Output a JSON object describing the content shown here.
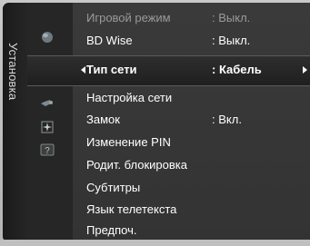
{
  "sidebar": {
    "title": "Установка"
  },
  "icons": [
    "picture-icon",
    "setup-icon",
    "sound-icon",
    "channel-icon",
    "support-icon"
  ],
  "menu": {
    "items": [
      {
        "label": "Игровой режим",
        "value": ": Выкл.",
        "state": "dim"
      },
      {
        "label": "BD Wise",
        "value": ": Выкл.",
        "state": "normal"
      },
      {
        "label": "Тип сети",
        "value": ": Кабель",
        "state": "selected"
      },
      {
        "label": "Настройка сети",
        "value": "",
        "state": "normal"
      },
      {
        "label": "Замок",
        "value": ": Вкл.",
        "state": "normal"
      },
      {
        "label": "Изменение PIN",
        "value": "",
        "state": "normal"
      },
      {
        "label": "Родит. блокировка",
        "value": "",
        "state": "normal"
      },
      {
        "label": "Субтитры",
        "value": "",
        "state": "normal"
      },
      {
        "label": "Язык телетекста",
        "value": "",
        "state": "normal"
      },
      {
        "label": "Предпоч.",
        "value": "",
        "state": "normal"
      }
    ]
  },
  "colors": {
    "accent": "#ffffff",
    "dim": "#9a9a9a",
    "panel": "#2b2b2b"
  }
}
